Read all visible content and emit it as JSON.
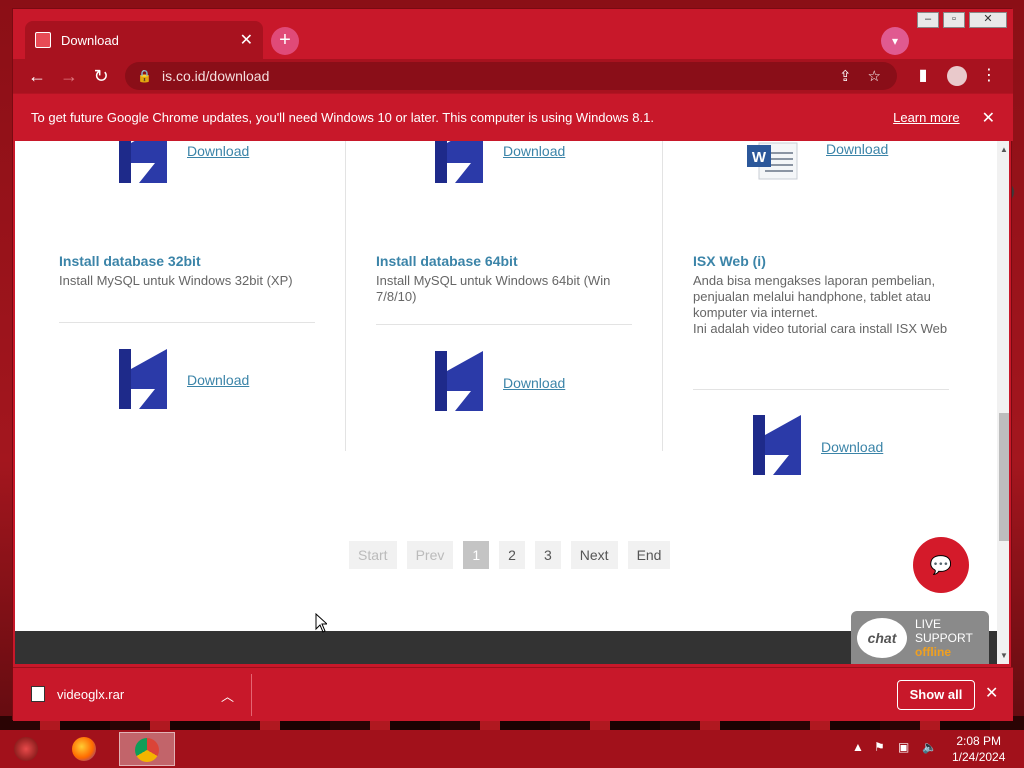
{
  "browser": {
    "tab_title": "Download",
    "url": "is.co.id/download"
  },
  "infobar": {
    "message": "To get future Google Chrome updates, you'll need Windows 10 or later. This computer is using Windows 8.1.",
    "learn_more": "Learn more"
  },
  "page": {
    "download_label": "Download",
    "items": [
      {
        "title": "Install database 32bit",
        "description": "Install MySQL untuk Windows 32bit (XP)"
      },
      {
        "title": "Install database 64bit",
        "description": "Install MySQL untuk Windows 64bit (Win 7/8/10)"
      },
      {
        "title": "ISX Web (i)",
        "description": "Anda bisa mengakses laporan pembelian, penjualan melalui handphone, tablet atau komputer via internet.\nIni adalah video tutorial cara install ISX Web"
      }
    ],
    "pagination": [
      "Start",
      "Prev",
      "1",
      "2",
      "3",
      "Next",
      "End"
    ],
    "active_page": "1"
  },
  "live_support": {
    "bubble": "chat",
    "line1": "LIVE",
    "line2": "SUPPORT",
    "status": "offline"
  },
  "download_shelf": {
    "file_name": "videoglx.rar",
    "show_all": "Show all"
  },
  "taskbar": {
    "time": "2:08 PM",
    "date": "1/24/2024"
  },
  "colors": {
    "chrome_theme": "#c8182a",
    "link": "#3b84a8",
    "chat_button": "#d41a2a",
    "support_offline": "#f0a020"
  }
}
